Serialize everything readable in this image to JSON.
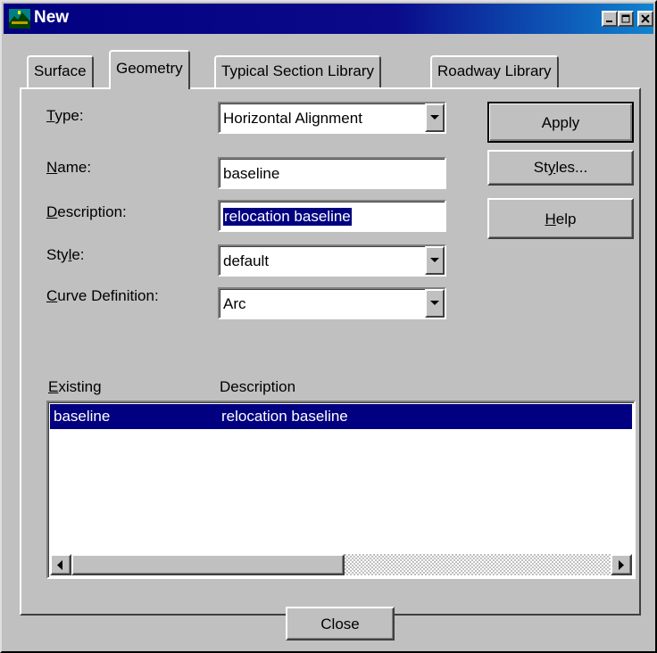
{
  "window": {
    "title": "New"
  },
  "tabs": [
    {
      "label": "Surface"
    },
    {
      "label": "Geometry"
    },
    {
      "label": "Typical Section Library"
    },
    {
      "label": "Roadway Library"
    }
  ],
  "form": {
    "type": {
      "label_key": "T",
      "label_rest": "ype:",
      "value": "Horizontal Alignment"
    },
    "name": {
      "label_key": "N",
      "label_rest": "ame:",
      "value": "baseline"
    },
    "description": {
      "label_key": "D",
      "label_rest": "escription:",
      "value": "relocation baseline"
    },
    "style": {
      "label_pre": "Sty",
      "label_key": "l",
      "label_rest": "e:",
      "value": "default"
    },
    "curve_definition": {
      "label_key": "C",
      "label_rest": "urve Definition:",
      "value": "Arc"
    }
  },
  "buttons": {
    "apply": "Apply",
    "styles_pre": "St",
    "styles_key": "y",
    "styles_rest": "les...",
    "help_key": "H",
    "help_rest": "elp",
    "close": "Close"
  },
  "list": {
    "col_existing_key": "E",
    "col_existing_rest": "xisting",
    "col_description": "Description",
    "rows": [
      {
        "name": "baseline",
        "description": "relocation baseline",
        "selected": true
      }
    ]
  },
  "colors": {
    "titlebar": "#000080",
    "selection": "#000080",
    "face": "#c0c0c0"
  }
}
